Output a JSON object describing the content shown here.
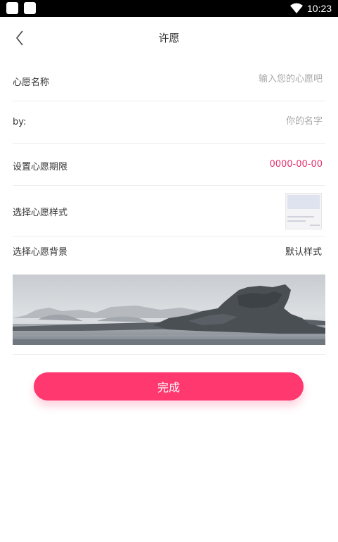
{
  "status_bar": {
    "time": "10:23",
    "icons": [
      "notification-square-icon",
      "notification-square-icon",
      "wifi-icon"
    ]
  },
  "header": {
    "back_icon": "chevron-left-icon",
    "title": "许愿"
  },
  "form": {
    "wish_name": {
      "label": "心愿名称",
      "placeholder": "输入您的心愿吧"
    },
    "by": {
      "label": "by:",
      "placeholder": "你的名字"
    },
    "deadline": {
      "label": "设置心愿期限",
      "value": "0000-00-00"
    },
    "wish_style": {
      "label": "选择心愿样式",
      "thumb_icon": "card-template-thumbnail"
    },
    "wish_background": {
      "label": "选择心愿背景",
      "value": "默认样式"
    }
  },
  "background_preview": {
    "icon": "misty-lake-landscape-image"
  },
  "actions": {
    "done_label": "完成"
  },
  "colors": {
    "accent": "#ff3870",
    "date_text": "#e5336f",
    "status_bar": "#000000"
  }
}
